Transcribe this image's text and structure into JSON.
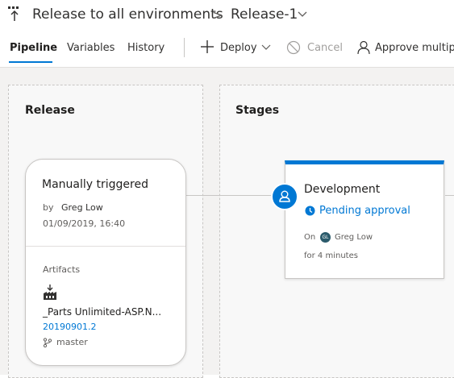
{
  "header": {
    "title": "Release to all environments",
    "separator": ">",
    "release_name": "Release-1"
  },
  "tabs": [
    {
      "label": "Pipeline",
      "active": true
    },
    {
      "label": "Variables",
      "active": false
    },
    {
      "label": "History",
      "active": false
    }
  ],
  "toolbar": {
    "deploy_label": "Deploy",
    "cancel_label": "Cancel",
    "approve_label": "Approve multiple"
  },
  "release_lane": {
    "title": "Release",
    "card": {
      "trigger_title": "Manually triggered",
      "by_text": "by",
      "by_user": "Greg Low",
      "date": "01/09/2019, 16:40",
      "artifacts_label": "Artifacts",
      "artifact_name": "_Parts Unlimited-ASP.N...",
      "artifact_version": "20190901.2",
      "branch": "master"
    }
  },
  "stages_lane": {
    "title": "Stages",
    "stage": {
      "name": "Development",
      "status": "Pending approval",
      "on_label": "On",
      "approver_initials": "GL",
      "approver_name": "Greg Low",
      "duration": "for 4 minutes"
    }
  },
  "colors": {
    "accent": "#0078d4",
    "canvas_bg": "#f3f2f1",
    "disabled_text": "#a19f9d"
  },
  "icons": [
    "release-pipeline-icon",
    "chevron-down-icon",
    "plus-icon",
    "cancel-icon",
    "person-icon",
    "artifact-build-icon",
    "branch-icon",
    "clock-icon",
    "avatar-person-icon"
  ]
}
